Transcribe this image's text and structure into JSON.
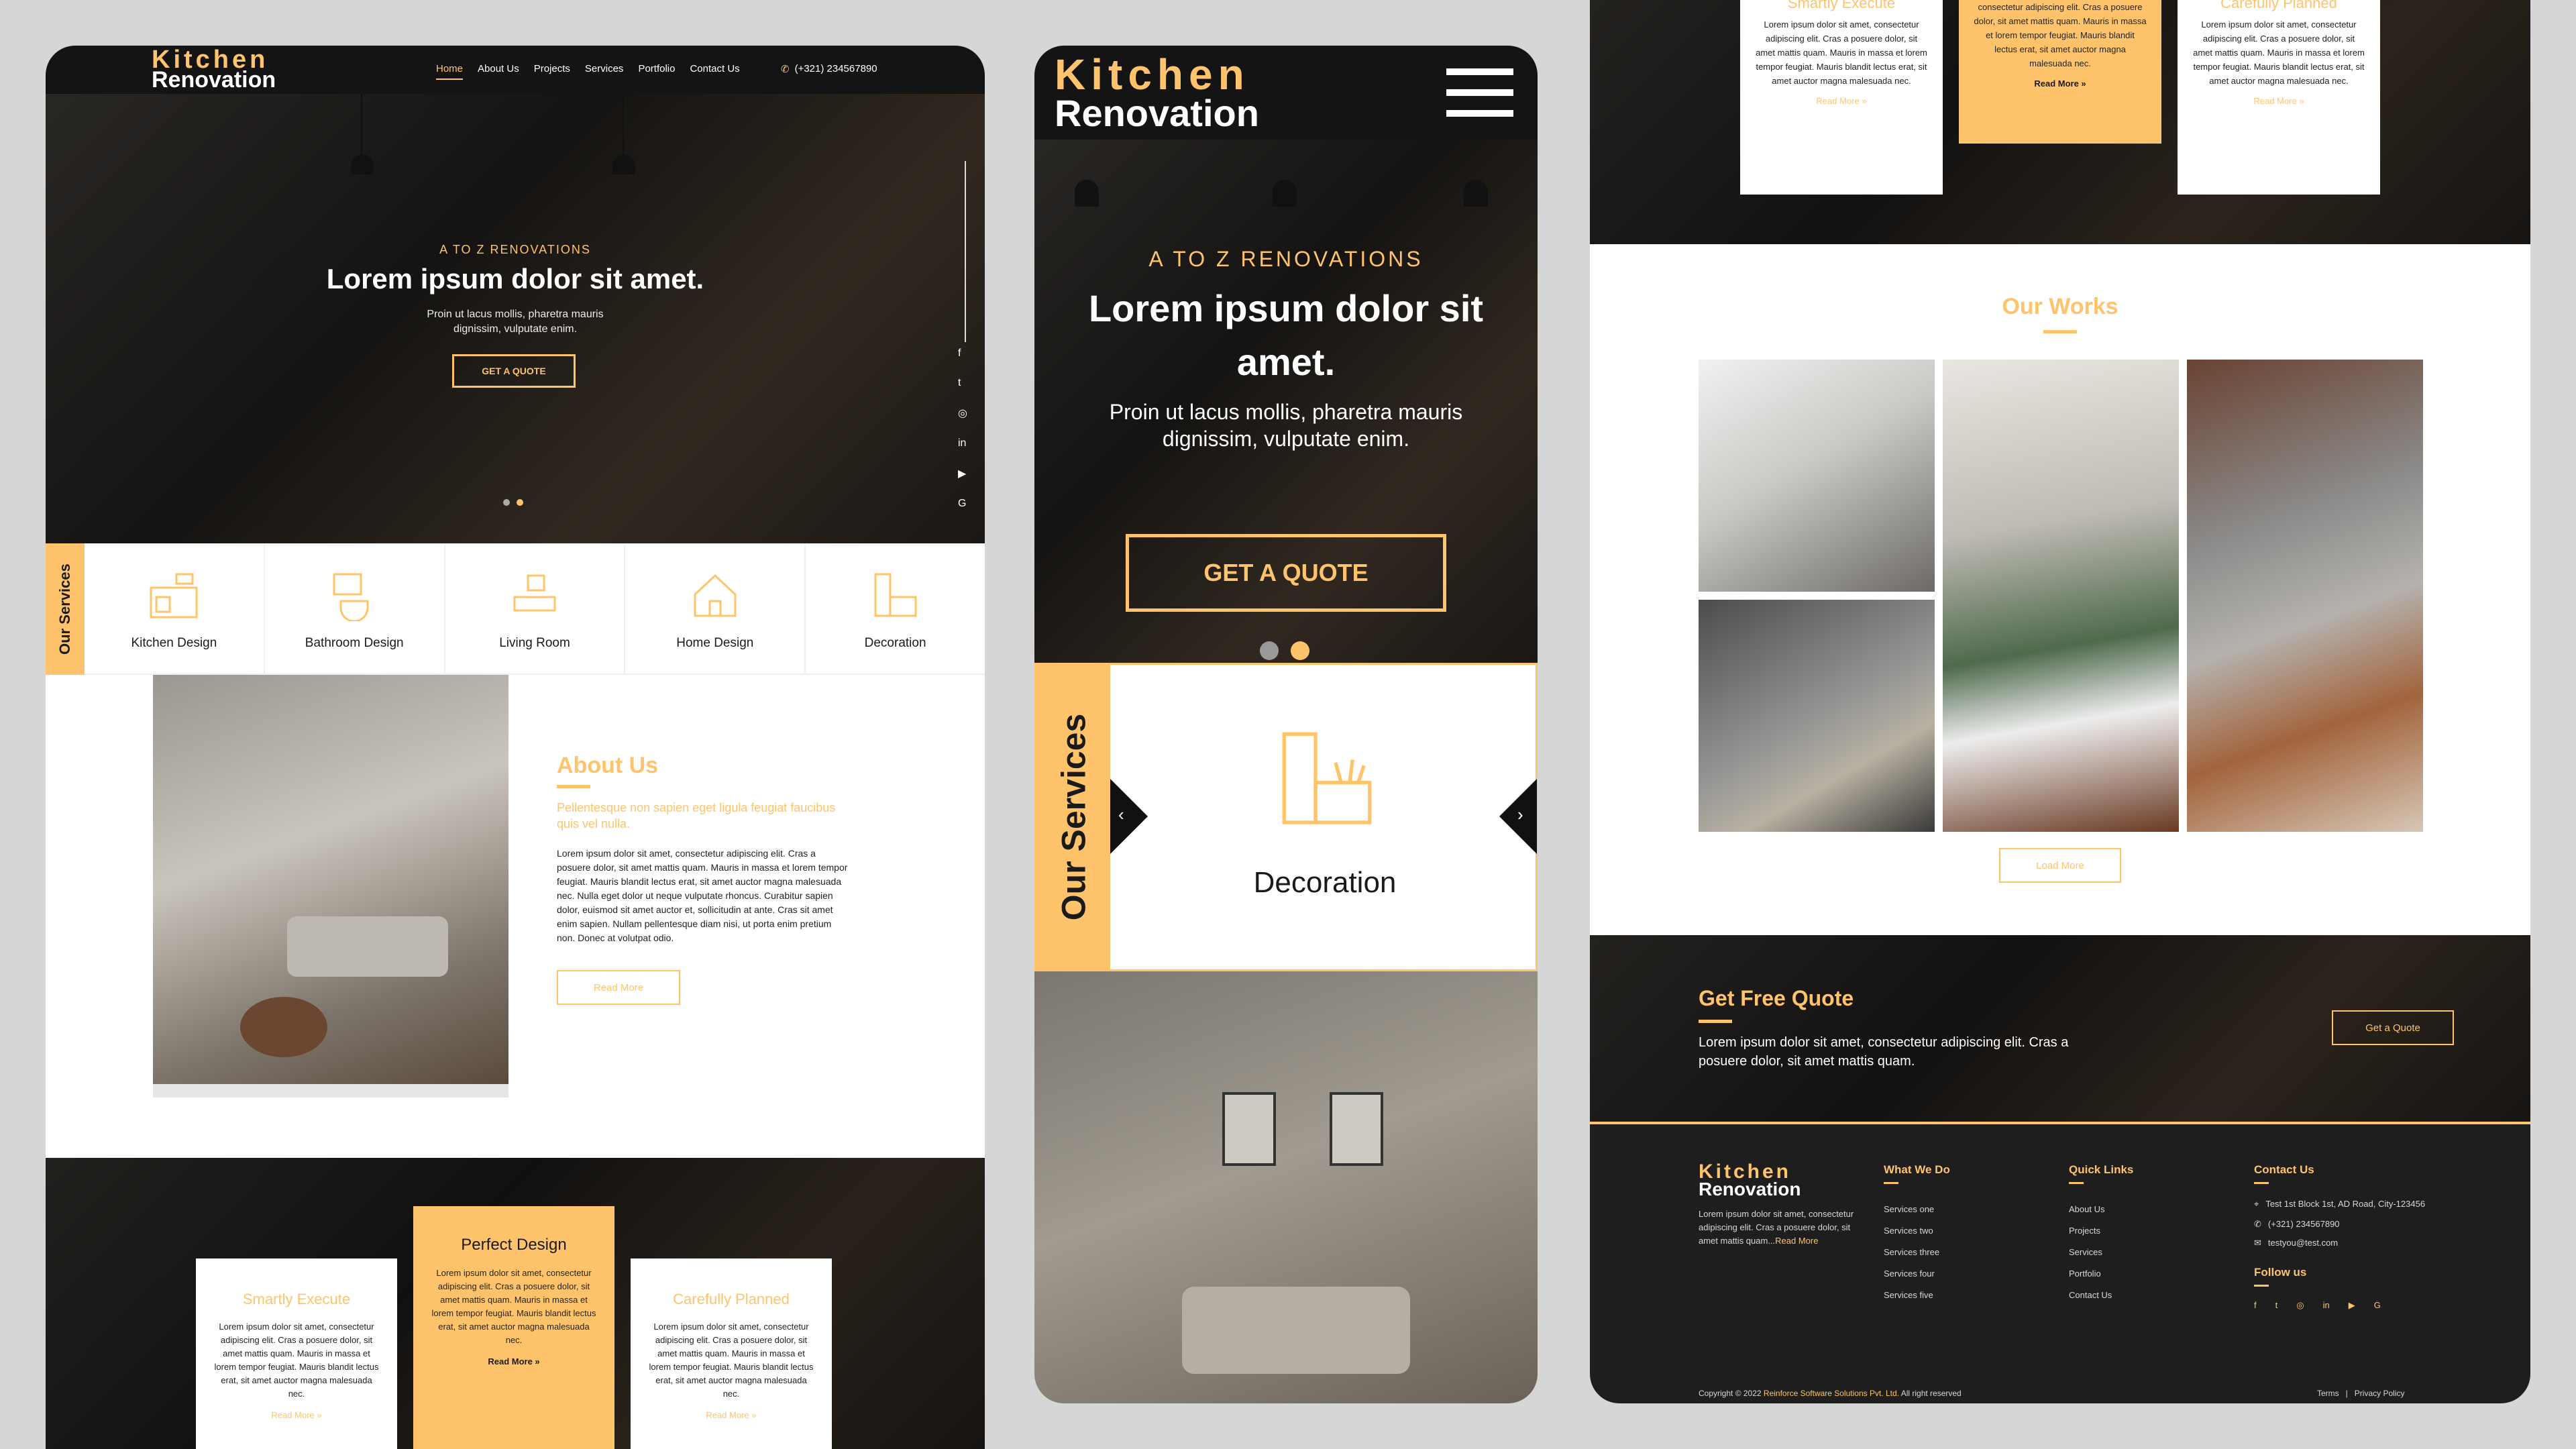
{
  "brand": {
    "line1": "Kitchen",
    "line2": "Renovation"
  },
  "nav": {
    "items": [
      "Home",
      "About Us",
      "Projects",
      "Services",
      "Portfolio",
      "Contact Us"
    ],
    "phone": "(+321) 234567890"
  },
  "hero": {
    "eyebrow": "A TO Z RENOVATIONS",
    "title": "Lorem ipsum dolor sit amet.",
    "title_mobile_1": "Lorem ipsum dolor sit",
    "title_mobile_2": "amet.",
    "subtitle_1": "Proin ut lacus mollis, pharetra mauris",
    "subtitle_2": "dignissim, vulputate enim.",
    "cta": "GET A QUOTE"
  },
  "services": {
    "label": "Our Services",
    "items": [
      "Kitchen Design",
      "Bathroom Design",
      "Living Room",
      "Home Design",
      "Decoration"
    ],
    "mobile_current": "Decoration"
  },
  "about": {
    "title": "About Us",
    "tagline": "Pellentesque non sapien eget ligula feugiat faucibus quis vel nulla.",
    "body": "Lorem ipsum dolor sit amet, consectetur adipiscing elit. Cras a posuere dolor, sit amet mattis quam. Mauris in massa et lorem tempor feugiat. Mauris blandit lectus erat, sit amet auctor magna malesuada nec. Nulla eget dolor ut neque vulputate rhoncus. Curabitur sapien dolor, euismod sit amet auctor et, sollicitudin at ante. Cras sit amet enim sapien. Nullam pellentesque diam nisi, ut porta enim pretium non. Donec at volutpat odio.",
    "button": "Read More"
  },
  "features": [
    {
      "title": "Smartly Execute",
      "body": "Lorem ipsum dolor sit amet, consectetur adipiscing elit. Cras a posuere dolor, sit amet mattis quam. Mauris in massa et lorem tempor feugiat. Mauris blandit lectus erat, sit amet auctor magna malesuada nec.",
      "link": "Read More »"
    },
    {
      "title": "Perfect Design",
      "body": "Lorem ipsum dolor sit amet, consectetur adipiscing elit. Cras a posuere dolor, sit amet mattis quam. Mauris in massa et lorem tempor feugiat. Mauris blandit lectus erat, sit amet auctor magna malesuada nec.",
      "link": "Read More »"
    },
    {
      "title": "Carefully Planned",
      "body": "Lorem ipsum dolor sit amet, consectetur adipiscing elit. Cras a posuere dolor, sit amet mattis quam. Mauris in massa et lorem tempor feugiat. Mauris blandit lectus erat, sit amet auctor magna malesuada nec.",
      "link": "Read More »"
    }
  ],
  "right_features_top": {
    "c1_title": "Smartly Execute",
    "c1_body": "Lorem ipsum dolor sit amet, consectetur adipiscing elit. Cras a posuere dolor, sit amet mattis quam. Mauris in massa et lorem tempor feugiat. Mauris blandit lectus erat, sit amet auctor magna malesuada nec.",
    "c1_link": "Read More »",
    "c2_body": "consectetur adipiscing elit. Cras a posuere dolor, sit amet mattis quam. Mauris in massa et lorem tempor feugiat. Mauris blandit lectus erat, sit amet auctor magna malesuada nec.",
    "c2_link": "Read More »",
    "c3_title": "Carefully Planned",
    "c3_body": "Lorem ipsum dolor sit amet, consectetur adipiscing elit. Cras a posuere dolor, sit amet mattis quam. Mauris in massa et lorem tempor feugiat. Mauris blandit lectus erat, sit amet auctor magna malesuada nec.",
    "c3_link": "Read More »"
  },
  "works": {
    "title": "Our Works",
    "button": "Load More"
  },
  "quote": {
    "title": "Get Free Quote",
    "body": "Lorem ipsum dolor sit amet, consectetur adipiscing elit. Cras a posuere dolor, sit amet mattis quam.",
    "button": "Get a Quote"
  },
  "footer": {
    "about": "Lorem ipsum dolor sit amet, consectetur adipiscing elit. Cras a posuere dolor, sit amet mattis quam...",
    "about_link": "Read More",
    "what_we_do": {
      "title": "What We Do",
      "items": [
        "Services one",
        "Services two",
        "Services three",
        "Services four",
        "Services five"
      ]
    },
    "quick_links": {
      "title": "Quick Links",
      "items": [
        "About Us",
        "Projects",
        "Services",
        "Portfolio",
        "Contact Us"
      ]
    },
    "contact": {
      "title": "Contact Us",
      "address": "Test 1st Block 1st, AD Road, City-123456",
      "phone": "(+321) 234567890",
      "email": "testyou@test.com"
    },
    "follow": "Follow us",
    "copyright_pre": "Copyright © 2022",
    "copyright_company": "Reinforce Software Solutions Pvt. Ltd.",
    "copyright_post": "All right reserved",
    "terms": "Terms",
    "privacy": "Privacy Policy"
  },
  "colors": {
    "accent": "#ffc46b",
    "dark": "#141414"
  }
}
